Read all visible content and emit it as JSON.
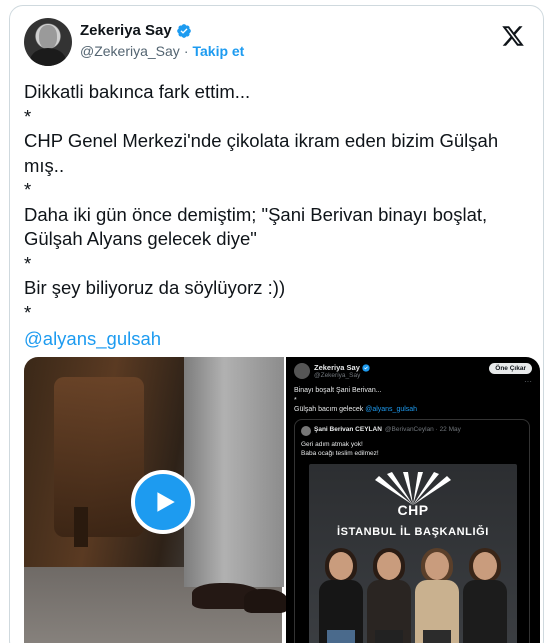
{
  "author": {
    "name": "Zekeriya Say",
    "handle": "@Zekeriya_Say",
    "separator": "·",
    "follow_label": "Takip et"
  },
  "tweet": {
    "lines": [
      "Dikkatli bakınca fark ettim...",
      "*",
      "CHP Genel Merkezi'nde çikolata ikram eden bizim Gülşah",
      "mış..",
      "*",
      "Daha iki gün önce demiştim; \"Şani Berivan binayı boşlat,",
      "Gülşah Alyans gelecek diye\"",
      "*",
      "Bir şey biliyoruz da söylüyorz :))",
      "*"
    ],
    "mention": "@alyans_gulsah"
  },
  "embedded_screenshot": {
    "author": "Zekeriya Say",
    "handle": "@Zekeriya_Say",
    "pinned_label": "Öne Çıkar",
    "more": "···",
    "line1": "Binayı boşalt Şani Berivan...",
    "line2": "*",
    "line3_text": "Gülşah bacım gelecek",
    "line3_mention": "@alyans_gulsah",
    "quote": {
      "author": "Şani Berivan CEYLAN",
      "handle_date": "@BerivanCeylan · 22 May",
      "line1": "Geri adım atmak yok!",
      "line2": "Baba ocağı teslim edilmez!"
    },
    "photo_logo": "CHP",
    "photo_sign": "İSTANBUL İL BAŞKANLIĞI"
  },
  "colors": {
    "accent": "#1d9bf0",
    "text": "#0f1419",
    "muted": "#536471",
    "border": "#cfd9de"
  },
  "icons": {
    "verified": "verified-badge-icon",
    "x_logo": "x-logo-icon",
    "play": "play-icon"
  }
}
